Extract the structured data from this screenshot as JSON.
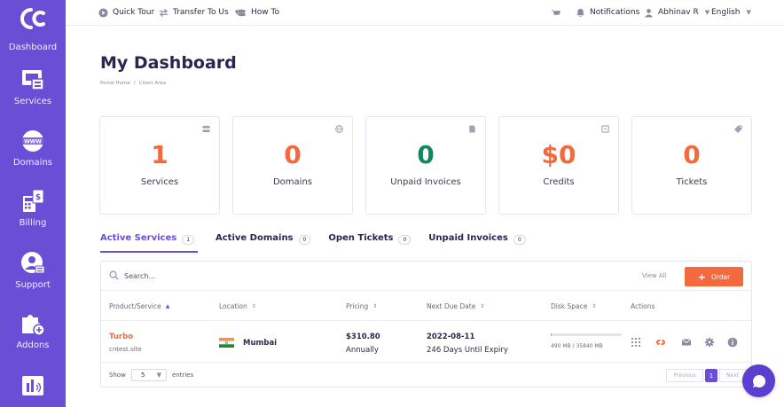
{
  "colors": {
    "sidebar": "#6a4fd6",
    "accent_orange": "#f4693d",
    "accent_green": "#11875d",
    "accent_purple": "#6a4fd6"
  },
  "sidebar": {
    "items": [
      {
        "label": "Dashboard",
        "icon": "logo-icon"
      },
      {
        "label": "Services",
        "icon": "services-icon"
      },
      {
        "label": "Domains",
        "icon": "www-icon"
      },
      {
        "label": "Billing",
        "icon": "billing-icon"
      },
      {
        "label": "Support",
        "icon": "support-icon"
      },
      {
        "label": "Addons",
        "icon": "puzzle-icon"
      },
      {
        "label": "",
        "icon": "affiliate-icon"
      }
    ]
  },
  "topbar": {
    "quick_tour": "Quick Tour",
    "transfer": "Transfer To Us",
    "how_to": "How To",
    "notifications": "Notifications",
    "user": "Abhinav R",
    "language": "English"
  },
  "page": {
    "title": "My Dashboard",
    "breadcrumb": [
      "Portal Home",
      "/",
      "Client Area"
    ]
  },
  "stats": [
    {
      "value": "1",
      "label": "Services",
      "color": "#f4693d",
      "icon": "server-icon"
    },
    {
      "value": "0",
      "label": "Domains",
      "color": "#f4693d",
      "icon": "globe-icon"
    },
    {
      "value": "0",
      "label": "Unpaid Invoices",
      "color": "#11875d",
      "icon": "document-icon"
    },
    {
      "value": "$0",
      "label": "Credits",
      "color": "#f4693d",
      "icon": "wallet-icon"
    },
    {
      "value": "0",
      "label": "Tickets",
      "color": "#f4693d",
      "icon": "tag-icon"
    }
  ],
  "tabs": [
    {
      "label": "Active Services",
      "count": "1"
    },
    {
      "label": "Active Domains",
      "count": "0"
    },
    {
      "label": "Open Tickets",
      "count": "0"
    },
    {
      "label": "Unpaid Invoices",
      "count": "0"
    }
  ],
  "table": {
    "search_placeholder": "Search...",
    "view_all": "View All",
    "order_label": "Order",
    "columns": [
      "Product/Service",
      "Location",
      "Pricing",
      "Next Due Date",
      "Disk Space",
      "Actions"
    ],
    "rows": [
      {
        "product": "Turbo",
        "domain": "cntest.site",
        "location": "Mumbai",
        "price": "$310.80",
        "cycle": "Annually",
        "due_date": "2022-08-11",
        "due_sub": "246 Days Until Expiry",
        "disk_text": "490 MB / 35840 MB",
        "disk_fraction": 0.0137
      }
    ],
    "show_label": "Show",
    "show_value": "5",
    "entries_label": "entries",
    "prev_label": "Previous",
    "page_number": "1",
    "next_label": "Next"
  }
}
